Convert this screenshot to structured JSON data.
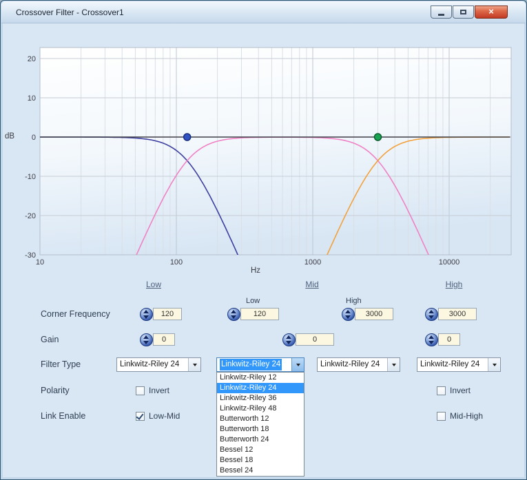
{
  "window": {
    "title": "Crossover Filter - Crossover1"
  },
  "chart_data": {
    "type": "line",
    "xlabel": "Hz",
    "ylabel": "dB",
    "x_scale": "log",
    "x_ticks": [
      10,
      100,
      1000,
      10000
    ],
    "y_ticks": [
      20,
      10,
      0,
      -10,
      -20,
      -30
    ],
    "x_range": [
      10,
      28000
    ],
    "y_range": [
      -30,
      23
    ],
    "grid": true,
    "series": [
      {
        "name": "low-band-lowpass",
        "shape": "lowpass",
        "filter": "Linkwitz-Riley 24",
        "fc": 120,
        "color": "#3c3f9e"
      },
      {
        "name": "mid-band-bandpass",
        "shape": "bandpass",
        "filter": "Linkwitz-Riley 24",
        "fc_low": 120,
        "fc_high": 3000,
        "color": "#ef82c4"
      },
      {
        "name": "high-band-highpass",
        "shape": "highpass",
        "filter": "Linkwitz-Riley 24",
        "fc": 3000,
        "color": "#f2a13c"
      },
      {
        "name": "summed-response",
        "shape": "flat",
        "level_db": 0,
        "color": "#3f3f46"
      }
    ],
    "markers": [
      {
        "name": "low-mid-crossover-handle",
        "x": 120,
        "y": 0,
        "color": "#3353c4",
        "outline": "#16307e"
      },
      {
        "name": "mid-high-crossover-handle",
        "x": 3000,
        "y": 0,
        "color": "#19a251",
        "outline": "#0b5e2c"
      }
    ]
  },
  "columns": {
    "low": "Low",
    "mid": "Mid",
    "high": "High"
  },
  "rows": {
    "corner_frequency": {
      "label": "Corner Frequency",
      "mid_sub_labels": {
        "low": "Low",
        "high": "High"
      },
      "values": {
        "low": "120",
        "mid_low": "120",
        "mid_high": "3000",
        "high": "3000"
      }
    },
    "gain": {
      "label": "Gain",
      "values": {
        "low": "0",
        "mid": "0",
        "high": "0"
      }
    },
    "filter_type": {
      "label": "Filter Type",
      "values": {
        "low": "Linkwitz-Riley 24",
        "mid_low": "Linkwitz-Riley 24",
        "mid_high": "Linkwitz-Riley 24",
        "high": "Linkwitz-Riley 24"
      }
    },
    "polarity": {
      "label": "Polarity",
      "low_checkbox": "Invert",
      "high_checkbox": "Invert",
      "low_checked": false,
      "high_checked": false
    },
    "link_enable": {
      "label": "Link Enable",
      "low_checkbox": "Low-Mid",
      "high_checkbox": "Mid-High",
      "low_checked": true,
      "high_checked": false
    }
  },
  "dropdown": {
    "items": [
      "Linkwitz-Riley 12",
      "Linkwitz-Riley 24",
      "Linkwitz-Riley 36",
      "Linkwitz-Riley 48",
      "Butterworth 12",
      "Butterworth 18",
      "Butterworth 24",
      "Bessel 12",
      "Bessel 18",
      "Bessel 24"
    ],
    "selected_index": 1,
    "selected": "Linkwitz-Riley 24"
  }
}
